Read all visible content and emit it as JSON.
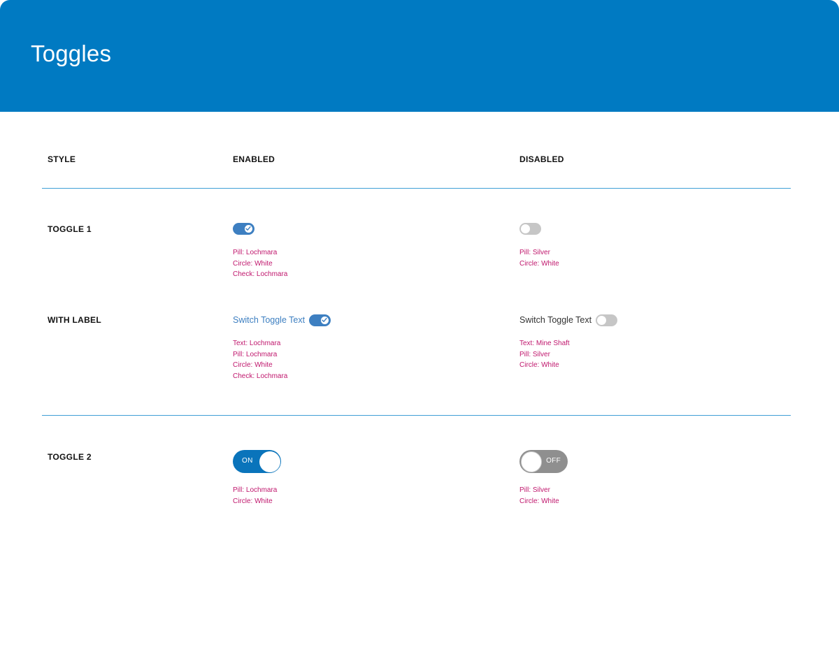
{
  "header": {
    "title": "Toggles"
  },
  "columns": {
    "style": "STYLE",
    "enabled": "ENABLED",
    "disabled": "DISABLED"
  },
  "colors": {
    "header": "#007ac2",
    "lochmara": "#3d7fc1",
    "silver": "#c6c6c6",
    "mine_shaft": "#333333",
    "spec_text": "#c0176d",
    "toggle2_on": "#0a74bb",
    "toggle2_off": "#8f8f8f"
  },
  "rows": {
    "toggle1": {
      "label": "TOGGLE 1",
      "enabled": {
        "checked": true,
        "specs": [
          "Pill: Lochmara",
          "Circle: White",
          "Check: Lochmara"
        ]
      },
      "disabled": {
        "checked": false,
        "specs": [
          "Pill: Silver",
          "Circle: White"
        ]
      }
    },
    "with_label": {
      "label": "WITH LABEL",
      "enabled": {
        "text": "Switch Toggle Text",
        "checked": true,
        "specs": [
          "Text: Lochmara",
          "Pill: Lochmara",
          "Circle: White",
          "Check: Lochmara"
        ]
      },
      "disabled": {
        "text": "Switch Toggle Text",
        "checked": false,
        "specs": [
          "Text: Mine Shaft",
          "Pill: Silver",
          "Circle: White"
        ]
      }
    },
    "toggle2": {
      "label": "TOGGLE 2",
      "enabled": {
        "state": "ON",
        "specs": [
          "Pill: Lochmara",
          "Circle: White"
        ]
      },
      "disabled": {
        "state": "OFF",
        "specs": [
          "Pill: Silver",
          "Circle: White"
        ]
      }
    }
  }
}
